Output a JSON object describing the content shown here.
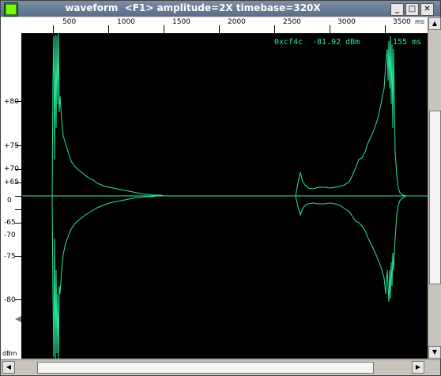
{
  "window": {
    "title": "waveform  <F1> amplitude=2X timebase=320X",
    "app_icon": "waveform-app-icon",
    "controls": {
      "minimize": "_",
      "maximize": "□",
      "close": "✕"
    }
  },
  "time_ruler": {
    "labels": [
      "500",
      "1000",
      "1500",
      "2000",
      "2500",
      "3000",
      "3500"
    ],
    "unit": "ms"
  },
  "amplitude_ruler": {
    "labels": [
      "+80",
      "+75",
      "+70",
      "+65",
      "0",
      "-65",
      "-70",
      "-75",
      "-80"
    ],
    "unit": "dBm"
  },
  "readout": {
    "address": "0xcf4c",
    "level": "-81.92 dBm",
    "time": "155 ms"
  },
  "colors": {
    "trace": "#22e89a",
    "background": "#000000",
    "baseline": "#3fe0c0"
  }
}
